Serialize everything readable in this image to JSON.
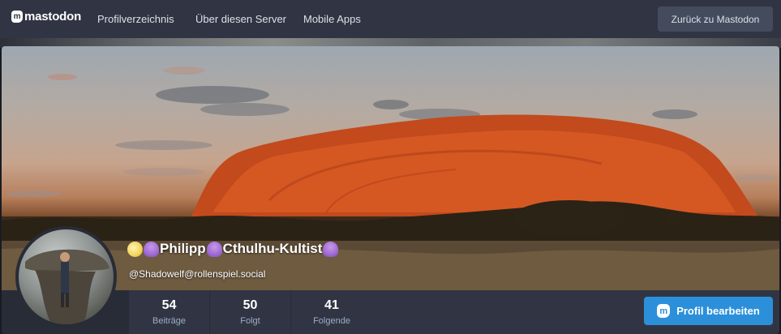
{
  "topbar": {
    "brand": "mastodon",
    "brand_icon": "mastodon-logo-icon",
    "links": [
      "Profilverzeichnis",
      "Über diesen Server",
      "Mobile Apps"
    ],
    "back_button": "Zurück zu Mastodon"
  },
  "profile": {
    "display_name": "Philipp",
    "display_name_part2": "Cthulhu-Kultist",
    "emojis": [
      "moon-emoji",
      "octopus-emoji"
    ],
    "handle": "@Shadowelf@rollenspiel.social",
    "banner": "uluru-at-sunset",
    "avatar": "man-on-rock-formation"
  },
  "counters": [
    {
      "value": "54",
      "label": "Beiträge"
    },
    {
      "value": "50",
      "label": "Folgt"
    },
    {
      "value": "41",
      "label": "Folgende"
    }
  ],
  "actions": {
    "edit_profile": "Profil bearbeiten",
    "edit_profile_icon": "mastodon-icon"
  },
  "colors": {
    "topbar": "#313543",
    "card": "#282c37",
    "accent": "#2b90d9",
    "text_secondary": "#9baec8"
  }
}
